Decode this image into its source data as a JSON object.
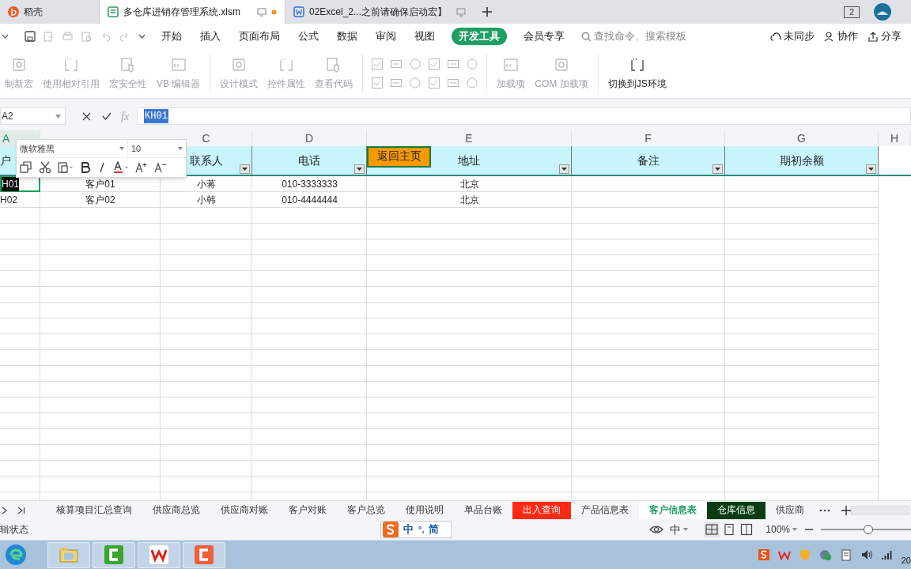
{
  "app_tabs": [
    {
      "label": "稻壳",
      "selected": false,
      "kind": "home"
    },
    {
      "label": "多仓库进销存管理系统.xlsm",
      "selected": true,
      "kind": "sheet"
    },
    {
      "label": "02Excel_2...之前请确保启动宏】",
      "selected": false,
      "kind": "doc"
    }
  ],
  "window_count": "2",
  "menu": [
    {
      "label": "开始",
      "selected": false
    },
    {
      "label": "插入",
      "selected": false
    },
    {
      "label": "页面布局",
      "selected": false
    },
    {
      "label": "公式",
      "selected": false
    },
    {
      "label": "数据",
      "selected": false
    },
    {
      "label": "审阅",
      "selected": false
    },
    {
      "label": "视图",
      "selected": false
    },
    {
      "label": "开发工具",
      "selected": true
    },
    {
      "label": "会员专享",
      "selected": false
    }
  ],
  "search": {
    "placeholder": "查找命令、搜索模板"
  },
  "menu_right": [
    "未同步",
    "协作",
    "分享"
  ],
  "ribbon": [
    {
      "kind": "big",
      "label": "制新宏",
      "disabled": true
    },
    {
      "kind": "big",
      "label": "使用相对引用",
      "disabled": true
    },
    {
      "kind": "big",
      "label": "宏安全性",
      "disabled": true
    },
    {
      "kind": "big",
      "label": "VB 编辑器",
      "disabled": true
    },
    {
      "kind": "sep"
    },
    {
      "kind": "big",
      "label": "设计模式",
      "disabled": true
    },
    {
      "kind": "big",
      "label": "控件属性",
      "disabled": true
    },
    {
      "kind": "big",
      "label": "查看代码",
      "disabled": true
    },
    {
      "kind": "sep"
    },
    {
      "kind": "grid",
      "disabled": true
    },
    {
      "kind": "sep"
    },
    {
      "kind": "big",
      "label": "加载项",
      "disabled": true
    },
    {
      "kind": "big",
      "label": "COM 加载项",
      "disabled": true
    },
    {
      "kind": "sep"
    },
    {
      "kind": "big",
      "label": "切换到JS环境",
      "disabled": false
    }
  ],
  "name_box": "A2",
  "formula": "KH01",
  "function_label": "fx",
  "columns": [
    {
      "letter": "A",
      "header": "户",
      "selected": true
    },
    {},
    {
      "letter": "C",
      "header": "联系人",
      "filter": true,
      "selected": false
    },
    {
      "letter": "D",
      "header": "电话",
      "filter": true,
      "selected": false
    },
    {
      "letter": "E",
      "header": "地址",
      "filter": true,
      "selected": false
    },
    {
      "letter": "F",
      "header": "备注",
      "filter": true,
      "selected": false
    },
    {
      "letter": "G",
      "header": "期初余额",
      "filter": true,
      "selected": false
    },
    {
      "letter": "H",
      "selected": false
    }
  ],
  "rows": [
    {
      "selected": true,
      "values": [
        "H01",
        "客户01",
        "小蒋",
        "010-3333333",
        "北京"
      ]
    },
    {
      "selected": false,
      "values": [
        "H02",
        "客户02",
        "小韩",
        "010-4444444",
        "北京"
      ]
    }
  ],
  "float_button": "返回主页",
  "mini_toolbar": {
    "font": "微软雅黑",
    "size": "10"
  },
  "sheet_tabs": [
    {
      "label": "核算项目汇总查询",
      "selected": false
    },
    {
      "label": "供应商总览",
      "selected": false
    },
    {
      "label": "供应商对账",
      "selected": false
    },
    {
      "label": "客户对账",
      "selected": false
    },
    {
      "label": "客户总览",
      "selected": false
    },
    {
      "label": "使用说明",
      "selected": false
    },
    {
      "label": "单品台账",
      "selected": false
    },
    {
      "label": "出入查询",
      "selected": false,
      "color": "#ff2a14"
    },
    {
      "label": "产品信息表",
      "selected": false
    },
    {
      "label": "客户信息表",
      "selected": true
    },
    {
      "label": "仓库信息",
      "selected": false,
      "color": "#0a3d14"
    },
    {
      "label": "供应商",
      "selected": false
    }
  ],
  "status": {
    "mode": "辑状态",
    "ime": "中",
    "ime_punct": "°,",
    "ime_mode": "简",
    "lang": "中",
    "zoom": "100%",
    "zoom_slider": {
      "level": 0.5
    }
  },
  "taskbar": {
    "clock": "20"
  }
}
